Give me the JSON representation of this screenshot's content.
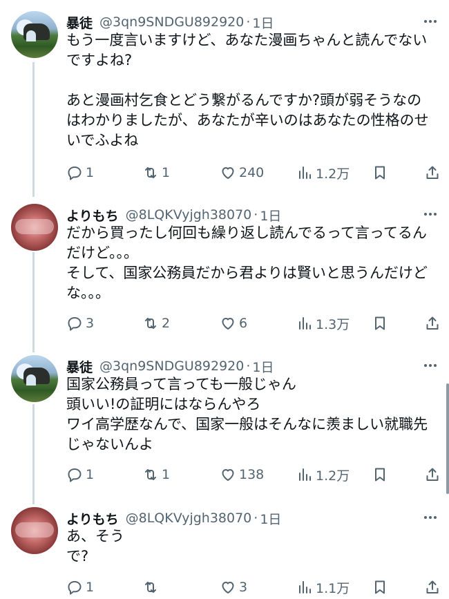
{
  "tweets": [
    {
      "author": "暴徒",
      "handle": "@3qn9SNDGU892920",
      "time": "1日",
      "avatar": "landscape-avatar",
      "text": "もう一度言いますけど、あなた漫画ちゃんと読んでないですよね?\n\nあと漫画村乞食とどう繋がるんですか?頭が弱そうなのはわかりましたが、あなたが辛いのはあなたの性格のせいでふよね",
      "replies": "1",
      "retweets": "1",
      "likes": "240",
      "views": "1.2万"
    },
    {
      "author": "よりもち",
      "handle": "@8LQKVyjgh38070",
      "time": "1日",
      "avatar": "blurred-avatar",
      "text": "だから買ったし何回も繰り返し読んでるって言ってるんだけど。。。\nそして、国家公務員だから君よりは賢いと思うんだけどな。。。",
      "replies": "3",
      "retweets": "2",
      "likes": "6",
      "views": "1.3万"
    },
    {
      "author": "暴徒",
      "handle": "@3qn9SNDGU892920",
      "time": "1日",
      "avatar": "landscape-avatar",
      "text": "国家公務員って言っても一般じゃん\n頭いい!の証明にはならんやろ\nワイ高学歴なんで、国家一般はそんなに羨ましい就職先じゃないんよ",
      "replies": "1",
      "retweets": "1",
      "likes": "138",
      "views": "1.2万"
    },
    {
      "author": "よりもち",
      "handle": "@8LQKVyjgh38070",
      "time": "1日",
      "avatar": "blurred-avatar",
      "text": "あ、そう\nで?",
      "replies": "1",
      "retweets": "",
      "likes": "3",
      "views": "1.1万"
    }
  ],
  "ui": {
    "dot_separator": "·"
  },
  "icons": {
    "reply": "reply-icon",
    "retweet": "retweet-icon",
    "like": "heart-icon",
    "views": "views-chart-icon",
    "bookmark": "bookmark-icon",
    "share": "share-icon",
    "more": "more-icon"
  },
  "colors": {
    "text": "#0f1419",
    "muted": "#536471",
    "thread_line": "#cfd9de"
  }
}
